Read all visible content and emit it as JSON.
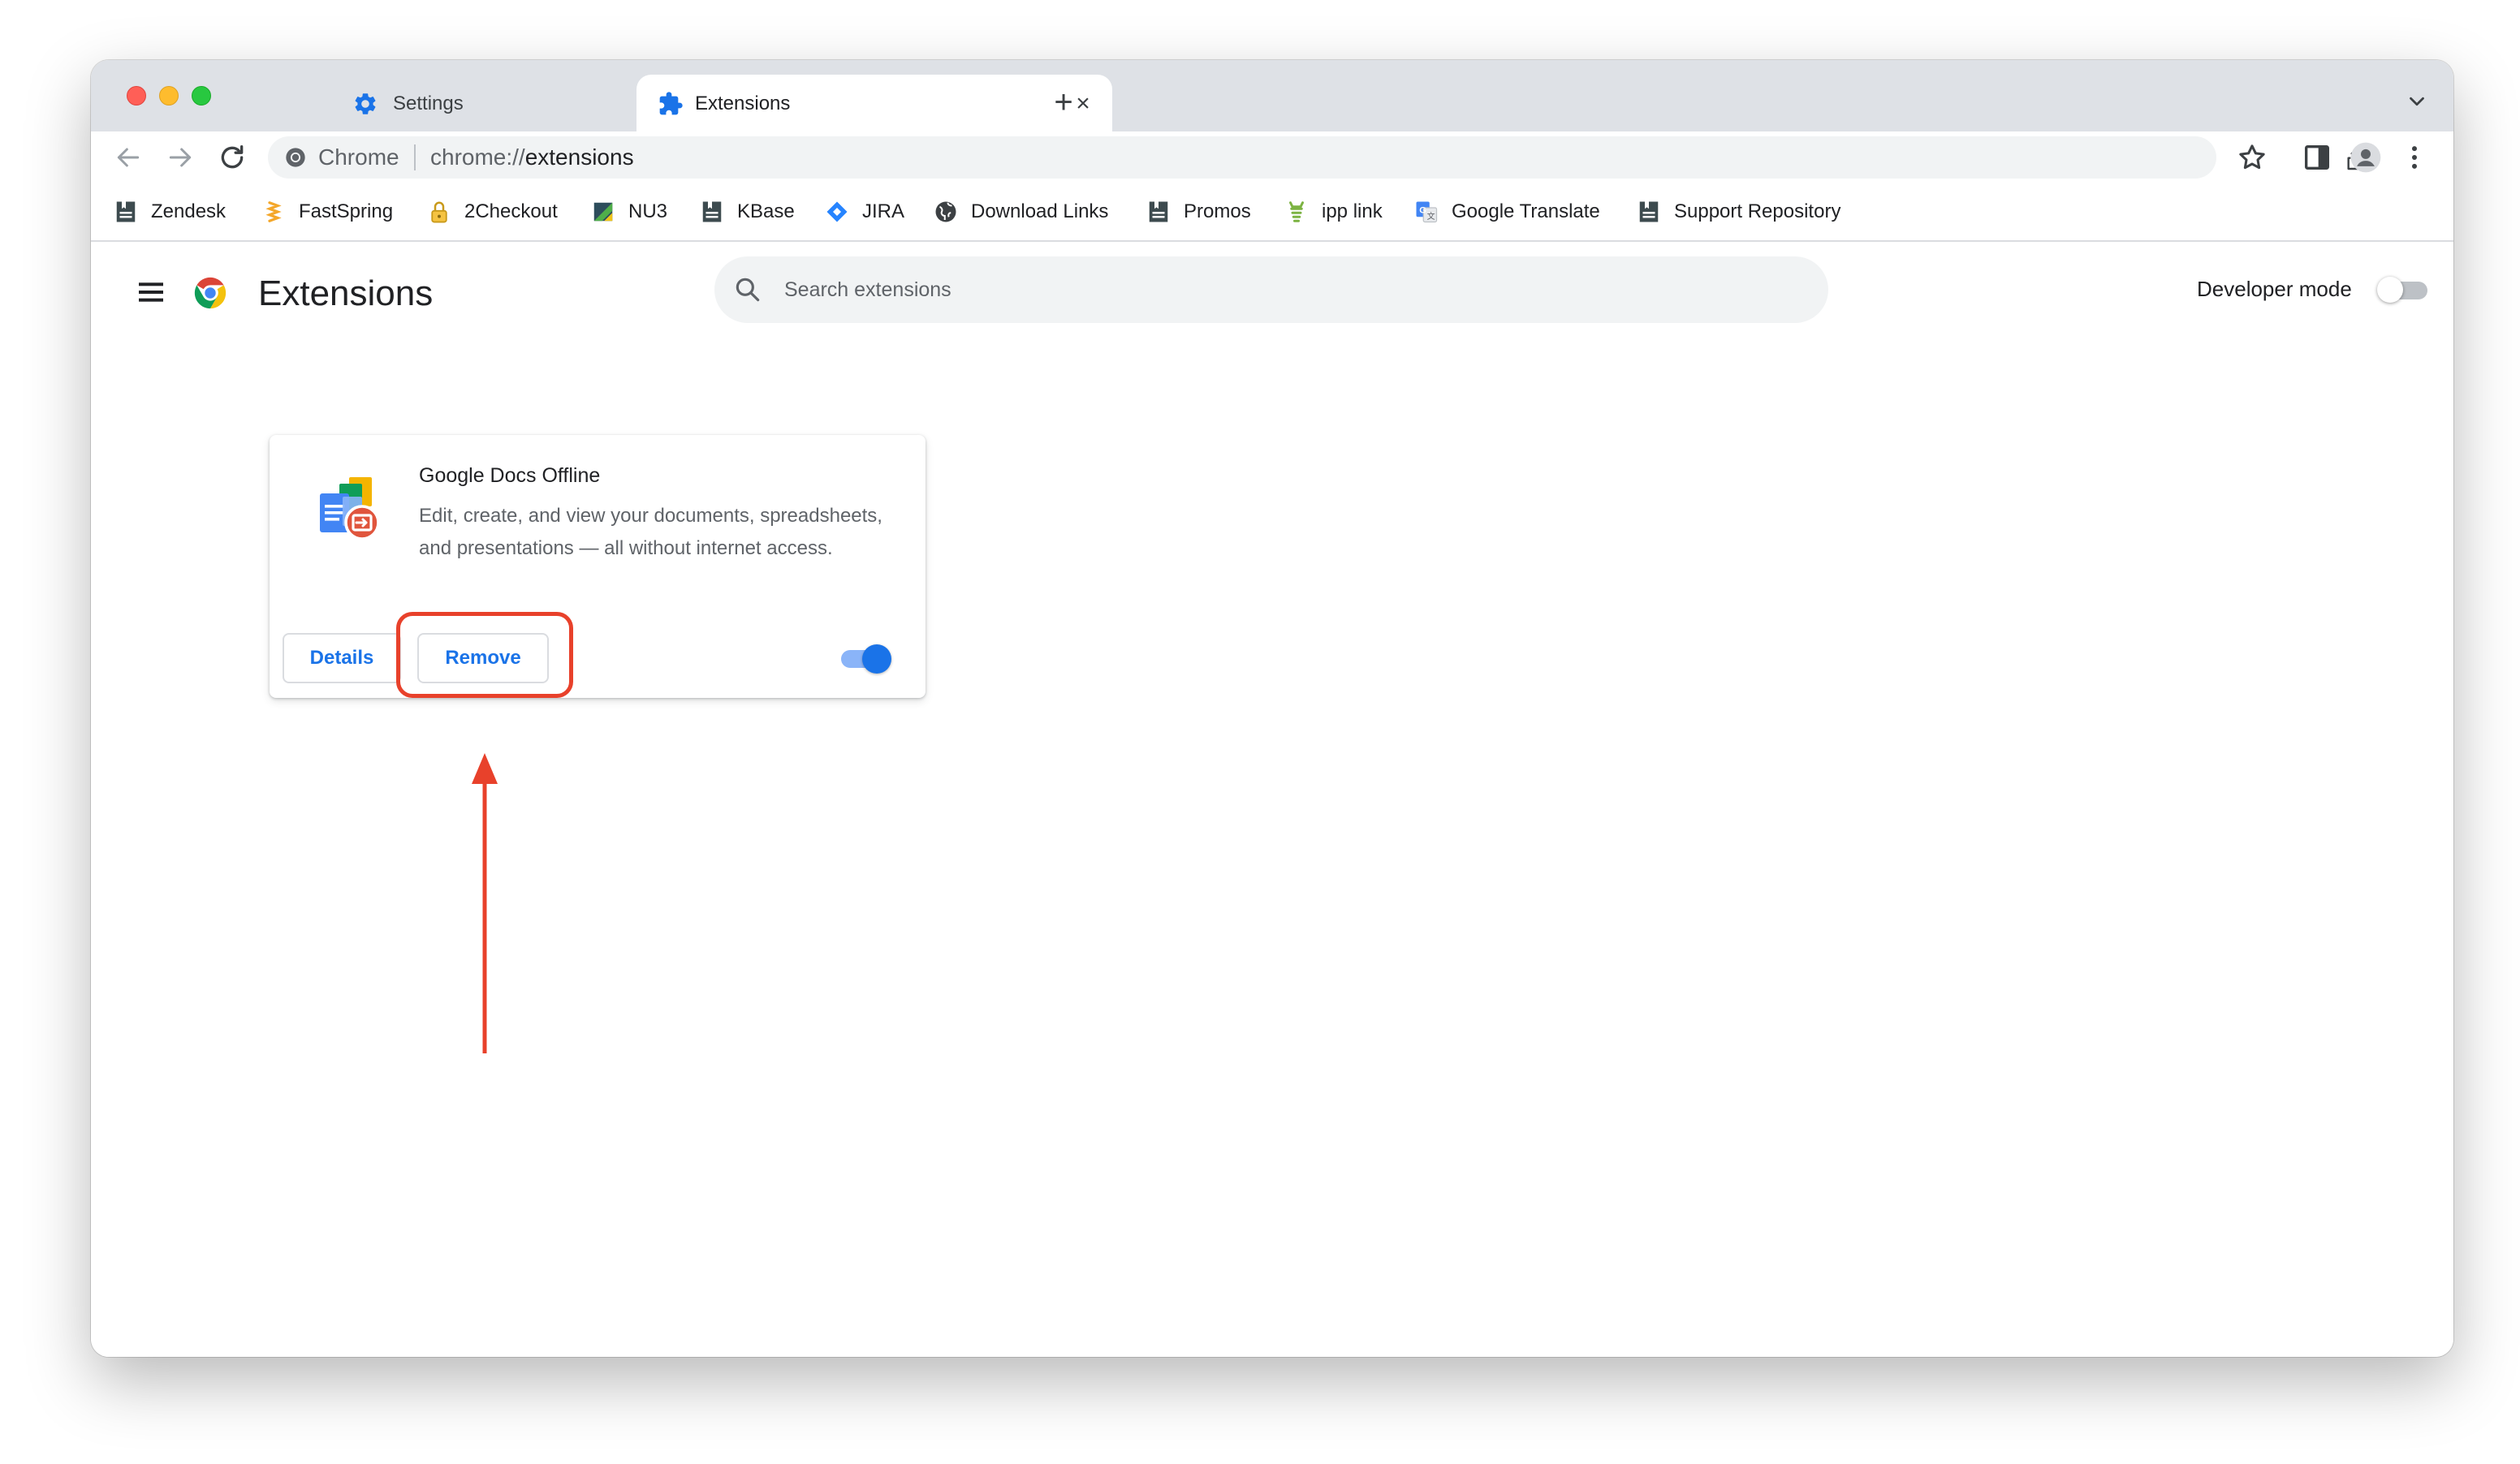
{
  "tabs": [
    {
      "title": "Settings",
      "icon": "gear-icon",
      "active": false
    },
    {
      "title": "Extensions",
      "icon": "puzzle-icon",
      "active": true
    }
  ],
  "omnibox": {
    "origin_label": "Chrome",
    "url_scheme": "chrome://",
    "url_path": "extensions"
  },
  "bookmarks": [
    {
      "label": "Zendesk",
      "icon": "bookmark-doc-icon"
    },
    {
      "label": "FastSpring",
      "icon": "fastspring-icon"
    },
    {
      "label": "2Checkout",
      "icon": "lock-icon"
    },
    {
      "label": "NU3",
      "icon": "nu3-icon"
    },
    {
      "label": "KBase",
      "icon": "bookmark-doc-icon"
    },
    {
      "label": "JIRA",
      "icon": "jira-icon"
    },
    {
      "label": "Download Links",
      "icon": "globe-icon"
    },
    {
      "label": "Promos",
      "icon": "bookmark-doc-icon"
    },
    {
      "label": "ipp link",
      "icon": "ipp-icon"
    },
    {
      "label": "Google Translate",
      "icon": "translate-icon"
    },
    {
      "label": "Support Repository",
      "icon": "bookmark-doc-icon"
    }
  ],
  "page": {
    "title": "Extensions",
    "search_placeholder": "Search extensions",
    "developer_mode_label": "Developer mode",
    "developer_mode_on": false
  },
  "extension": {
    "name": "Google Docs Offline",
    "description": "Edit, create, and view your documents, spreadsheets, and presentations — all without internet access.",
    "details_label": "Details",
    "remove_label": "Remove",
    "enabled": true
  },
  "colors": {
    "accent": "#1a73e8",
    "annotation": "#e8412b"
  }
}
